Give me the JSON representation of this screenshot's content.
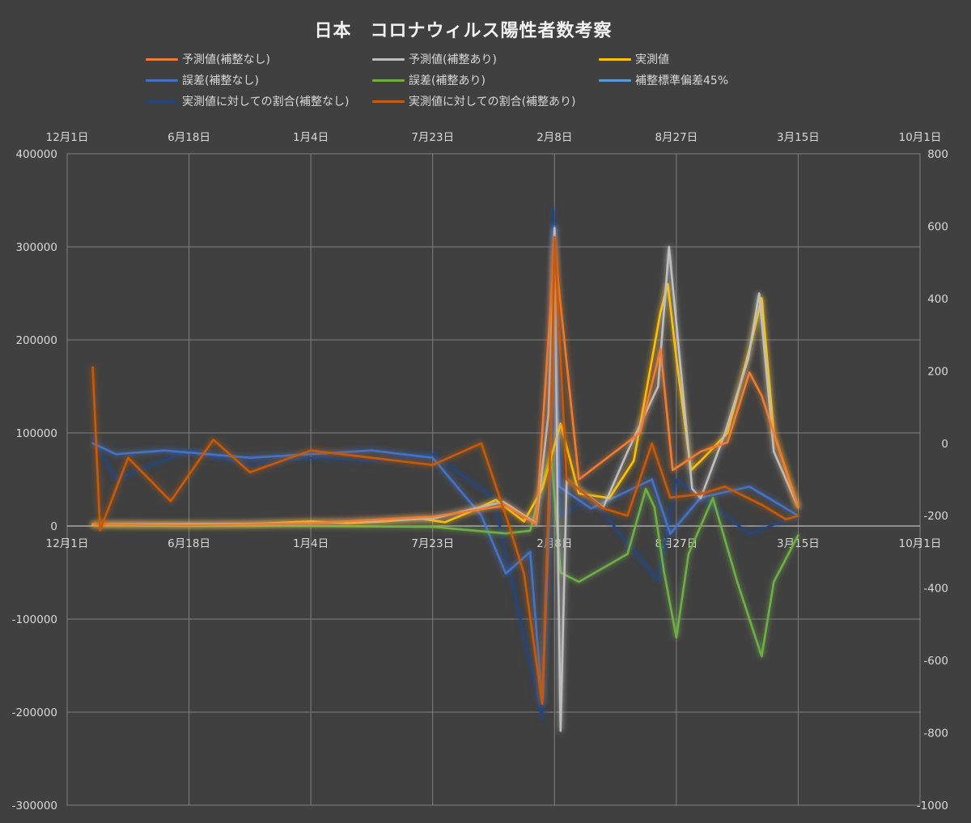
{
  "chart_data": {
    "type": "line",
    "title": "日本　コロナウィルス陽性者数考察",
    "x_ticks": [
      "12月1日",
      "6月18日",
      "1月4日",
      "7月23日",
      "2月8日",
      "8月27日",
      "3月15日",
      "10月1日"
    ],
    "y_left": {
      "min": -300000,
      "max": 400000,
      "step": 100000,
      "ticks": [
        "400000",
        "300000",
        "200000",
        "100000",
        "0",
        "-100000",
        "-200000",
        "-300000"
      ]
    },
    "y_right": {
      "min": -1000,
      "max": 800,
      "step": 200,
      "ticks": [
        "800",
        "600",
        "400",
        "200",
        "0",
        "-200",
        "-400",
        "-600",
        "-800",
        "-1000"
      ]
    },
    "grid": true,
    "legend_position": "top",
    "series": [
      {
        "name": "予測値(補整なし)",
        "color": "#ed7d31",
        "axis": "left",
        "points": [
          [
            0.21,
            2000
          ],
          [
            1.0,
            1000
          ],
          [
            2.0,
            3000
          ],
          [
            3.0,
            10000
          ],
          [
            3.6,
            22000
          ],
          [
            3.85,
            2000
          ],
          [
            4.0,
            300000
          ],
          [
            4.2,
            50000
          ],
          [
            4.7,
            100000
          ],
          [
            4.87,
            190000
          ],
          [
            4.97,
            60000
          ],
          [
            5.2,
            80000
          ],
          [
            5.42,
            90000
          ],
          [
            5.6,
            165000
          ],
          [
            5.7,
            140000
          ],
          [
            6.0,
            20000
          ]
        ]
      },
      {
        "name": "予測値(補整あり)",
        "color": "#bfbfbf",
        "axis": "left",
        "points": [
          [
            0.21,
            2000
          ],
          [
            1.0,
            2000
          ],
          [
            2.0,
            3000
          ],
          [
            3.0,
            8000
          ],
          [
            3.58,
            26000
          ],
          [
            3.85,
            3000
          ],
          [
            3.95,
            120000
          ],
          [
            4.0,
            320000
          ],
          [
            4.03,
            -40000
          ],
          [
            4.05,
            -220000
          ],
          [
            4.1,
            50000
          ],
          [
            4.4,
            20000
          ],
          [
            4.6,
            80000
          ],
          [
            4.85,
            150000
          ],
          [
            4.94,
            300000
          ],
          [
            5.02,
            190000
          ],
          [
            5.13,
            40000
          ],
          [
            5.2,
            30000
          ],
          [
            5.4,
            100000
          ],
          [
            5.59,
            180000
          ],
          [
            5.68,
            250000
          ],
          [
            5.8,
            80000
          ],
          [
            6.0,
            20000
          ]
        ]
      },
      {
        "name": "実測値",
        "color": "#ffc000",
        "axis": "left",
        "points": [
          [
            0.21,
            1500
          ],
          [
            1.0,
            1500
          ],
          [
            1.5,
            2000
          ],
          [
            2.0,
            5000
          ],
          [
            2.3,
            3000
          ],
          [
            2.6,
            5000
          ],
          [
            2.9,
            8000
          ],
          [
            3.1,
            4000
          ],
          [
            3.3,
            15000
          ],
          [
            3.52,
            28000
          ],
          [
            3.75,
            5000
          ],
          [
            3.9,
            40000
          ],
          [
            4.05,
            110000
          ],
          [
            4.2,
            35000
          ],
          [
            4.45,
            30000
          ],
          [
            4.65,
            70000
          ],
          [
            4.87,
            230000
          ],
          [
            4.93,
            260000
          ],
          [
            5.0,
            180000
          ],
          [
            5.12,
            60000
          ],
          [
            5.2,
            70000
          ],
          [
            5.42,
            100000
          ],
          [
            5.62,
            200000
          ],
          [
            5.7,
            245000
          ],
          [
            5.8,
            100000
          ],
          [
            6.0,
            20000
          ]
        ]
      },
      {
        "name": "誤差(補整なし)",
        "color": "#4472c4",
        "axis": "right",
        "points": [
          [
            0.21,
            0
          ],
          [
            0.4,
            -30
          ],
          [
            0.8,
            -20
          ],
          [
            1.5,
            -40
          ],
          [
            2.0,
            -30
          ],
          [
            2.5,
            -20
          ],
          [
            3.0,
            -40
          ],
          [
            3.4,
            -200
          ],
          [
            3.6,
            -360
          ],
          [
            3.8,
            -300
          ],
          [
            3.9,
            -720
          ],
          [
            3.96,
            -180
          ],
          [
            4.0,
            600
          ],
          [
            4.04,
            -120
          ],
          [
            4.3,
            -180
          ],
          [
            4.8,
            -100
          ],
          [
            4.95,
            -250
          ],
          [
            5.2,
            -150
          ],
          [
            5.6,
            -120
          ],
          [
            6.0,
            -200
          ]
        ]
      },
      {
        "name": "誤差(補整あり)",
        "color": "#70ad47",
        "axis": "left",
        "points": [
          [
            0.21,
            1000
          ],
          [
            1.0,
            0
          ],
          [
            2.0,
            0
          ],
          [
            3.0,
            -1000
          ],
          [
            3.6,
            -8000
          ],
          [
            3.8,
            -5000
          ],
          [
            3.97,
            80000
          ],
          [
            4.05,
            -50000
          ],
          [
            4.2,
            -60000
          ],
          [
            4.6,
            -30000
          ],
          [
            4.75,
            40000
          ],
          [
            4.82,
            20000
          ],
          [
            4.9,
            -50000
          ],
          [
            5.0,
            -120000
          ],
          [
            5.1,
            -30000
          ],
          [
            5.3,
            30000
          ],
          [
            5.5,
            -60000
          ],
          [
            5.7,
            -140000
          ],
          [
            5.8,
            -60000
          ],
          [
            6.0,
            -10000
          ]
        ]
      },
      {
        "name": "補整標準偏差45%",
        "color": "#5b9bd5",
        "axis": "left",
        "points": [
          [
            0.21,
            107000
          ],
          [
            6.0,
            107000
          ]
        ]
      },
      {
        "name": "実測値に対しての割合(補整なし)",
        "color": "#264478",
        "axis": "right",
        "points": [
          [
            0.21,
            20
          ],
          [
            0.4,
            -100
          ],
          [
            1.0,
            -20
          ],
          [
            1.5,
            -60
          ],
          [
            2.0,
            -40
          ],
          [
            2.5,
            -50
          ],
          [
            3.0,
            -30
          ],
          [
            3.5,
            -150
          ],
          [
            3.9,
            -760
          ],
          [
            3.96,
            -100
          ],
          [
            3.99,
            650
          ],
          [
            4.05,
            -200
          ],
          [
            4.3,
            -150
          ],
          [
            4.85,
            -380
          ],
          [
            5.0,
            -100
          ],
          [
            5.6,
            -250
          ],
          [
            6.0,
            -200
          ]
        ]
      },
      {
        "name": "実測値に対しての割合(補整あり)",
        "color": "#c55a11",
        "axis": "right",
        "points": [
          [
            0.21,
            210
          ],
          [
            0.27,
            -240
          ],
          [
            0.5,
            -40
          ],
          [
            0.85,
            -160
          ],
          [
            1.2,
            10
          ],
          [
            1.5,
            -80
          ],
          [
            2.0,
            -20
          ],
          [
            2.5,
            -40
          ],
          [
            3.0,
            -60
          ],
          [
            3.4,
            0
          ],
          [
            3.62,
            -220
          ],
          [
            3.75,
            -360
          ],
          [
            3.9,
            -720
          ],
          [
            3.97,
            40
          ],
          [
            4.0,
            570
          ],
          [
            4.1,
            -100
          ],
          [
            4.4,
            -180
          ],
          [
            4.6,
            -200
          ],
          [
            4.8,
            0
          ],
          [
            4.95,
            -150
          ],
          [
            5.2,
            -140
          ],
          [
            5.4,
            -120
          ],
          [
            5.7,
            -170
          ],
          [
            5.9,
            -210
          ],
          [
            6.0,
            -200
          ]
        ]
      }
    ]
  }
}
